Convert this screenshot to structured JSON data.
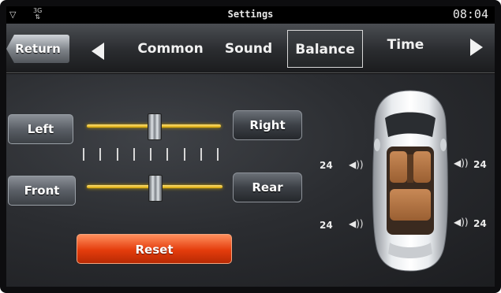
{
  "statusbar": {
    "signal_icon": "signal-icon",
    "network_label": "3G",
    "network_icon": "data-arrows-icon",
    "title": "Settings",
    "time": "08:04"
  },
  "tabbar": {
    "return_label": "Return",
    "prev_icon": "triangle-left-icon",
    "next_icon": "triangle-right-icon",
    "tabs": [
      {
        "label": "Common"
      },
      {
        "label": "Sound"
      },
      {
        "label": "Balance",
        "active": true
      },
      {
        "label": "Time"
      }
    ]
  },
  "balance": {
    "left_label": "Left",
    "right_label": "Right",
    "front_label": "Front",
    "rear_label": "Rear",
    "left_right_level": 0.5,
    "front_rear_level": 0.5
  },
  "reset_label": "Reset",
  "speakers": {
    "front_left": "24",
    "front_right": "24",
    "rear_left": "24",
    "rear_right": "24"
  },
  "colors": {
    "accent": "#f2b400",
    "reset": "#e43c0c"
  }
}
